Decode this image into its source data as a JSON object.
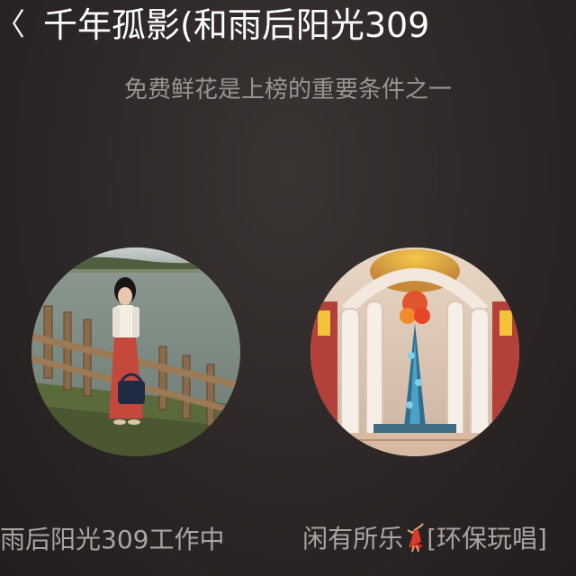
{
  "header": {
    "back_glyph": "〈",
    "title": "千年孤影(和雨后阳光309"
  },
  "banner": {
    "text": "免费鲜花是上榜的重要条件之一"
  },
  "users": [
    {
      "avatar_icon": "user-photo-woman-by-lake",
      "name": "雨后阳光309工作中"
    },
    {
      "avatar_icon": "user-photo-palace-chandelier",
      "name_before_icon": "闲有所乐",
      "name_icon": "dancer-icon",
      "name_after_icon": "[环保玩唱]"
    }
  ],
  "colors": {
    "background": "#2c2726",
    "title_text": "#ffffff",
    "secondary_text": "#9a9492"
  }
}
